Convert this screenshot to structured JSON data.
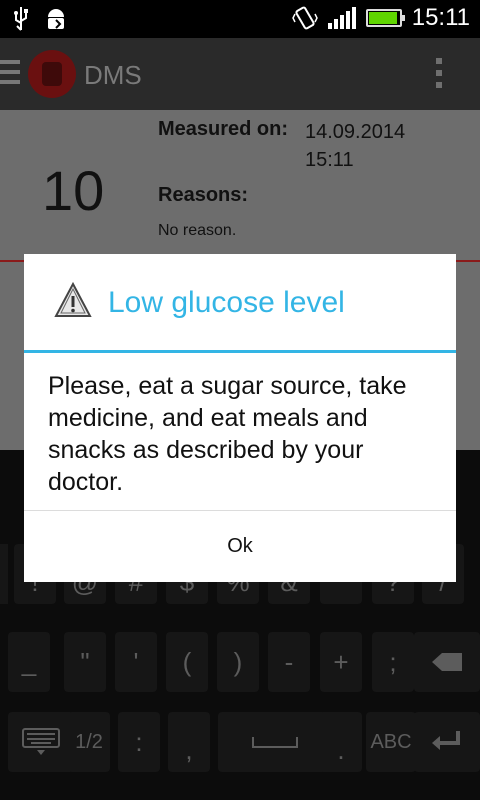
{
  "status_bar": {
    "time": "15:11",
    "icons": [
      "usb-icon",
      "android-debug-icon",
      "vibrate-icon",
      "signal-icon",
      "battery-icon"
    ]
  },
  "action_bar": {
    "title": "DMS",
    "icons": [
      "menu-icon",
      "app-logo-icon",
      "overflow-menu-icon"
    ]
  },
  "measurement": {
    "value": "10",
    "measured_label": "Measured on:",
    "measured_date": "14.09.2014",
    "measured_time": "15:11",
    "reasons_label": "Reasons:",
    "reasons_value": "No reason."
  },
  "dialog": {
    "title": "Low glucose level",
    "message": "Please, eat a sugar source, take medicine, and eat meals and snacks as described by your doctor.",
    "ok_label": "Ok",
    "icon": "warning-icon",
    "accent_color": "#33b5e5"
  },
  "keyboard": {
    "row1": [
      "!",
      "@",
      "#",
      "$",
      "%",
      "&",
      "*",
      "?",
      "/"
    ],
    "row2": [
      "_",
      "\"",
      "'",
      "(",
      ")",
      "-",
      "+",
      ";"
    ],
    "row3_left": "1/2",
    "row3_colon": ":",
    "row3_comma": ",",
    "row3_period": ".",
    "row3_abc": "ABC"
  }
}
